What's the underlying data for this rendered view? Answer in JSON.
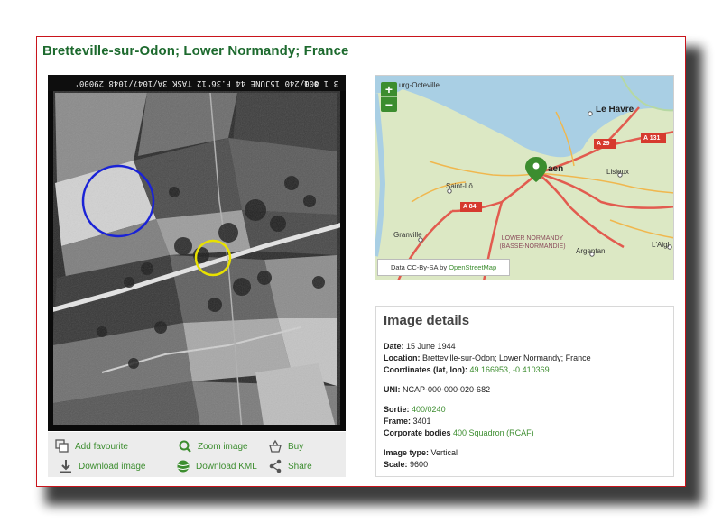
{
  "page": {
    "title": "Bretteville-sur-Odon; Lower Normandy; France"
  },
  "photo": {
    "header_strip": "400/240 15JUNE 44 F.36\"12 TASK 3A/1047/1048 29000'",
    "header_corner": "3 1 0 1"
  },
  "actions": {
    "add_favourite": "Add favourite",
    "zoom_image": "Zoom image",
    "buy": "Buy",
    "download_image": "Download image",
    "download_kml": "Download KML",
    "share": "Share"
  },
  "map": {
    "zoom_in": "+",
    "zoom_out": "−",
    "places": {
      "cherbourg": "urg-Octeville",
      "le_havre": "Le Havre",
      "caen": "aen",
      "lisieux": "Lisieux",
      "saint_lo": "Saint-Lô",
      "granville": "Granville",
      "region_line1": "LOWER NORMANDY",
      "region_line2": "(BASSE-NORMANDIE)",
      "argentan": "Argentan",
      "laigle": "L'Aigl"
    },
    "roads": {
      "a29": "A 29",
      "a131": "A 131",
      "a84": "A 84"
    },
    "attribution_prefix": "Data CC-By-SA by ",
    "attribution_link": "OpenStreetMap",
    "colors": {
      "sea": "#a9cfe4",
      "land": "#dce8c4",
      "road": "#e25b4f",
      "marker": "#3c8d2f"
    }
  },
  "details": {
    "heading": "Image details",
    "date_label": "Date:",
    "date_value": "15 June 1944",
    "location_label": "Location:",
    "location_value": "Bretteville-sur-Odon; Lower Normandy; France",
    "coords_label": "Coordinates (lat, lon):",
    "coords_value": "49.166953, -0.410369",
    "uni_label": "UNI:",
    "uni_value": "NCAP-000-000-020-682",
    "sortie_label": "Sortie:",
    "sortie_value": "400/0240",
    "frame_label": "Frame:",
    "frame_value": "3401",
    "corporate_label": "Corporate bodies",
    "corporate_value": "400 Squadron (RCAF)",
    "type_label": "Image type:",
    "type_value": "Vertical",
    "scale_label": "Scale:",
    "scale_value": "9600"
  }
}
